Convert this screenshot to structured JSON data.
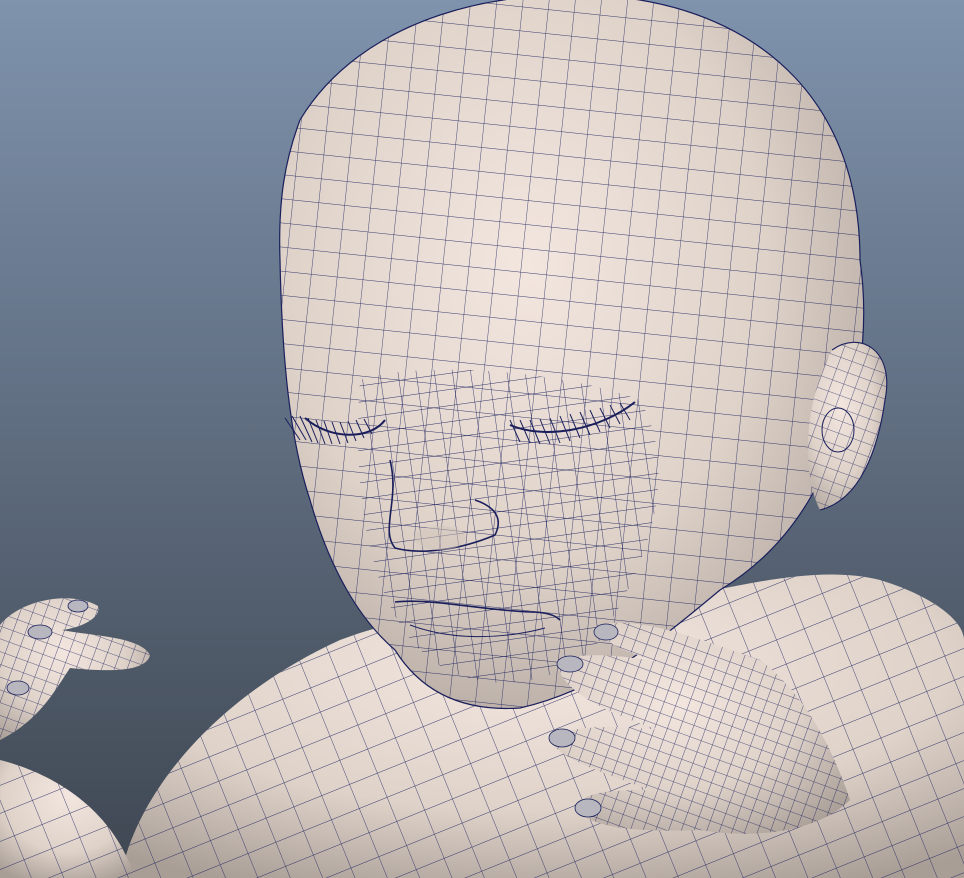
{
  "viewport": {
    "background_top": "#7f93ad",
    "background_bottom": "#3e4651"
  },
  "model": {
    "skin_highlight": "#f3e6df",
    "skin_base": "#ded2c9",
    "skin_shadow": "#a99e96",
    "wire_color": "#1a1f5c"
  }
}
